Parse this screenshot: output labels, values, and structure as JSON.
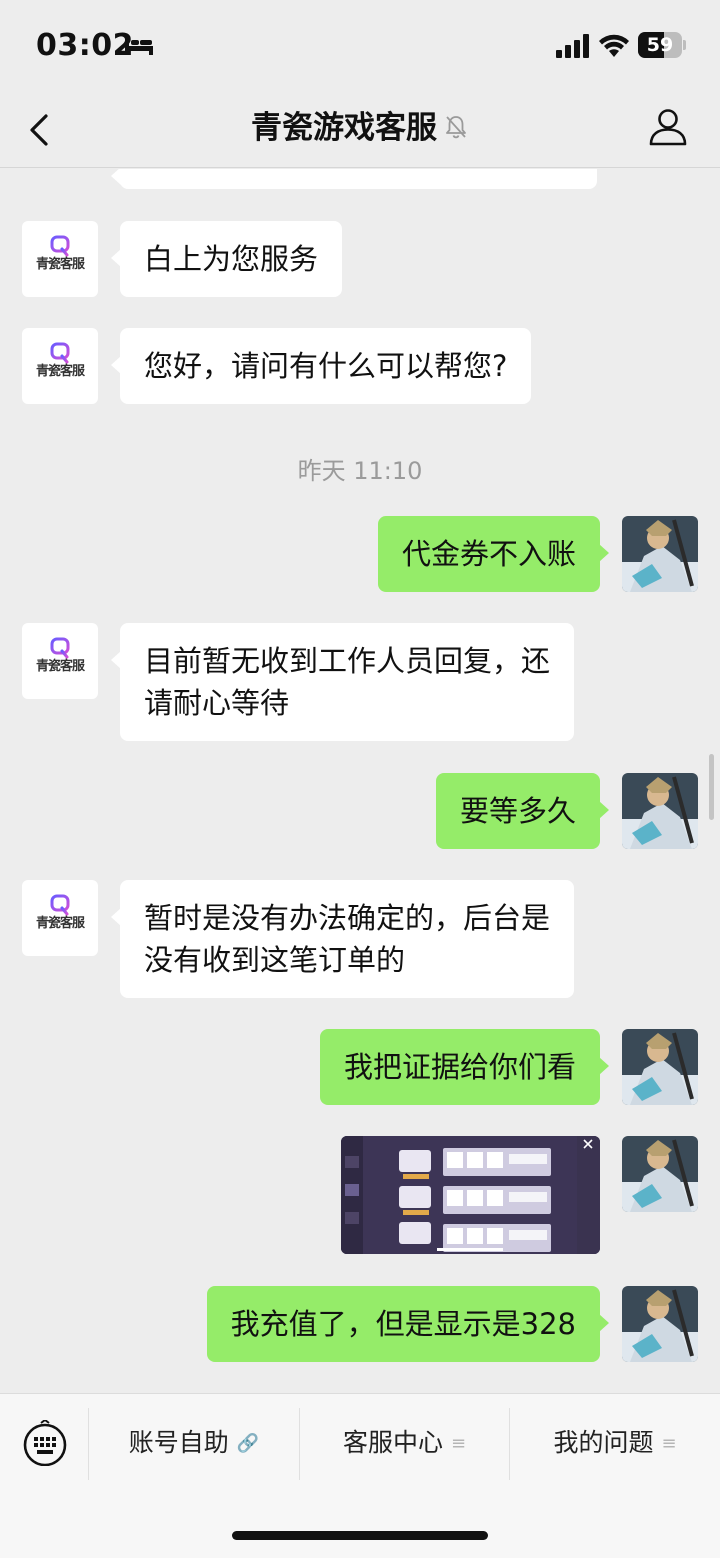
{
  "status_bar": {
    "time": "03:02",
    "battery": "59",
    "battery_level": 0.59,
    "icons": [
      "bed-icon",
      "signal-icon",
      "wifi-icon",
      "battery-icon"
    ]
  },
  "nav": {
    "title": "青瓷游戏客服",
    "icons": [
      "back-icon",
      "mute-icon",
      "profile-icon"
    ]
  },
  "cs_avatar": {
    "text": "青瓷客服"
  },
  "messages": {
    "m0": {
      "side": "left",
      "text": ""
    },
    "m1": {
      "side": "left",
      "text": "白上为您服务"
    },
    "m2": {
      "side": "left",
      "text": "您好，请问有什么可以帮您?"
    },
    "timestamp": "昨天 11:10",
    "m3": {
      "side": "right",
      "text": "代金券不入账"
    },
    "m4": {
      "side": "left",
      "line1": "目前暂无收到工作人员回复，还",
      "line2": "请耐心等待"
    },
    "m5": {
      "side": "right",
      "text": "要等多久"
    },
    "m6": {
      "side": "left",
      "line1": "暂时是没有办法确定的，后台是",
      "line2": "没有收到这笔订单的"
    },
    "m7": {
      "side": "right",
      "text": "我把证据给你们看"
    },
    "m8": {
      "side": "right",
      "type": "image"
    },
    "m9": {
      "side": "right",
      "text": "我充值了，但是显示是328"
    }
  },
  "bottom_menu": {
    "items": [
      {
        "label": "账号自助",
        "icon": "link-icon"
      },
      {
        "label": "客服中心",
        "icon": "menu-icon"
      },
      {
        "label": "我的问题",
        "icon": "menu-icon"
      }
    ]
  },
  "colors": {
    "background": "#ededed",
    "bubble_self": "#95ec69",
    "bubble_other": "#ffffff",
    "timestamp": "#9b9b9b"
  }
}
